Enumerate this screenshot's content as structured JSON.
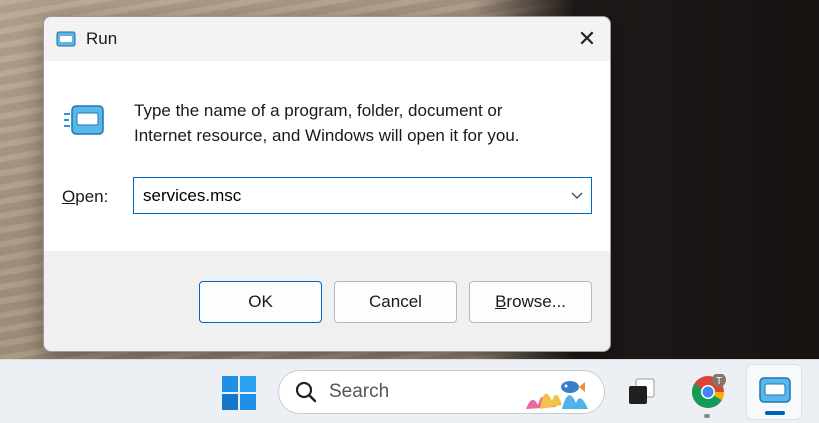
{
  "dialog": {
    "title": "Run",
    "close_glyph": "✕",
    "message_line1": "Type the name of a program, folder, document or",
    "message_line2": "Internet resource, and Windows will open it for you.",
    "open_label_accel": "O",
    "open_label_rest": "pen:",
    "open_value": "services.msc",
    "ok_label": "OK",
    "cancel_label": "Cancel",
    "browse_accel": "B",
    "browse_rest": "rowse...",
    "icon": "run-icon",
    "accent": "#0067c0"
  },
  "taskbar": {
    "search_label": "Search",
    "chrome_badge": "T",
    "icons": [
      "windows-start-icon",
      "search-icon",
      "task-view-icon",
      "chrome-icon",
      "run-icon"
    ]
  }
}
